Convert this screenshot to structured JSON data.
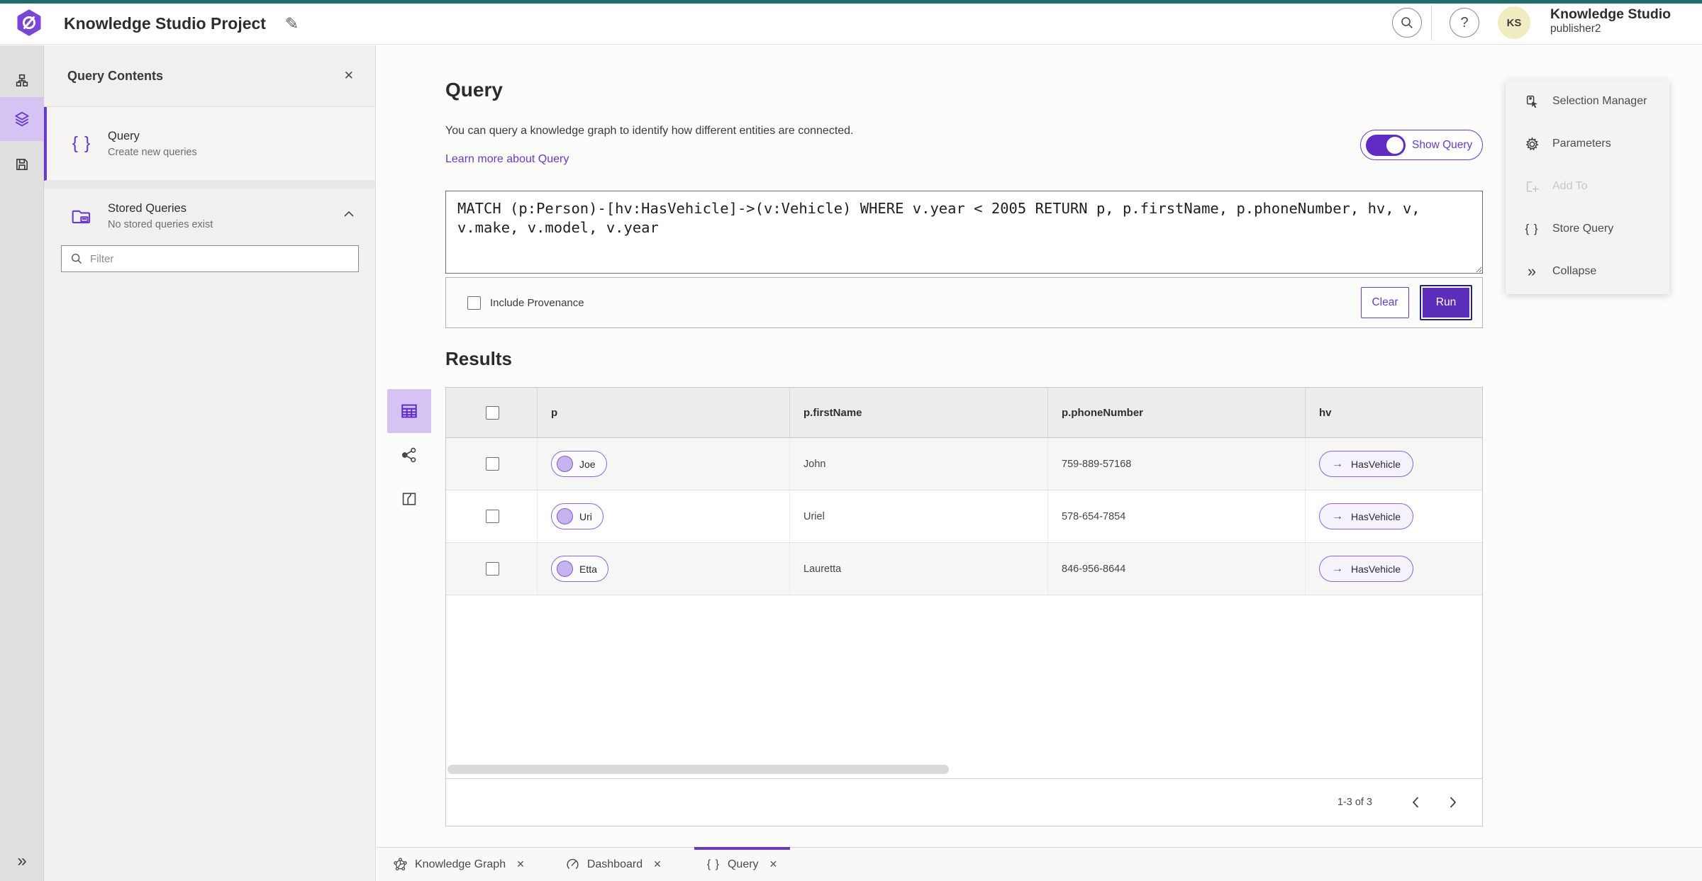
{
  "header": {
    "title": "Knowledge Studio Project",
    "app_name": "Knowledge Studio",
    "user_name": "publisher2",
    "avatar_initials": "KS"
  },
  "glyphs": {
    "close": "✕",
    "edit": "✎",
    "help": "?",
    "braces": "{ }",
    "chevron_double": "»",
    "arrow_right": "→"
  },
  "panel": {
    "title": "Query Contents",
    "query_item": {
      "label": "Query",
      "description": "Create new queries"
    },
    "stored_item": {
      "label": "Stored Queries",
      "description": "No stored queries exist"
    },
    "filter_placeholder": "Filter"
  },
  "query": {
    "title": "Query",
    "description": "You can query a knowledge graph to identify how different entities are connected.",
    "learn_more": "Learn more about Query",
    "show_query": "Show Query",
    "text": "MATCH (p:Person)-[hv:HasVehicle]->(v:Vehicle) WHERE v.year < 2005 RETURN p, p.firstName, p.phoneNumber, hv, v, v.make, v.model, v.year",
    "include_provenance": "Include Provenance",
    "clear": "Clear",
    "run": "Run"
  },
  "tools": {
    "selection_manager": "Selection Manager",
    "parameters": "Parameters",
    "add_to": "Add To",
    "store_query": "Store Query",
    "collapse": "Collapse"
  },
  "results": {
    "title": "Results",
    "columns": [
      "p",
      "p.firstName",
      "p.phoneNumber",
      "hv"
    ],
    "rows": [
      {
        "p": "Joe",
        "firstName": "John",
        "phoneNumber": "759-889-57168",
        "hv": "HasVehicle"
      },
      {
        "p": "Uri",
        "firstName": "Uriel",
        "phoneNumber": "578-654-7854",
        "hv": "HasVehicle"
      },
      {
        "p": "Etta",
        "firstName": "Lauretta",
        "phoneNumber": "846-956-8644",
        "hv": "HasVehicle"
      }
    ],
    "pagination": "1-3 of 3"
  },
  "tabs": [
    {
      "label": "Knowledge Graph"
    },
    {
      "label": "Dashboard"
    },
    {
      "label": "Query"
    }
  ],
  "colors": {
    "accent": "#6a39cb",
    "accent_dark": "#5b2db8",
    "toggle_fill": "#5f2bc4",
    "teal_topline": "#1f6e6b",
    "avatar_bg": "#f1ecc2",
    "rail_active_bg": "#d5c3f4",
    "entity_dot": "#c7b4ee"
  }
}
